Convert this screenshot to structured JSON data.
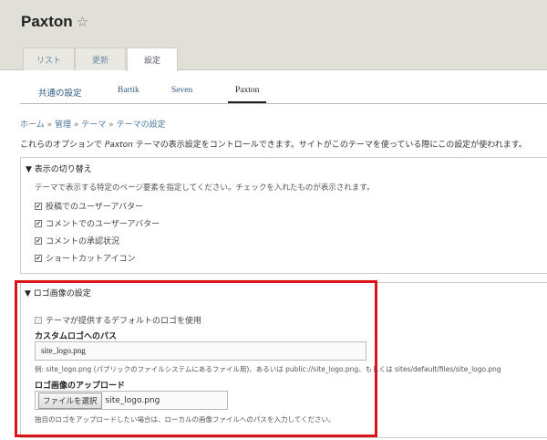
{
  "header": {
    "title": "Paxton",
    "tabs": [
      "リスト",
      "更新",
      "設定"
    ],
    "active_tab": "設定"
  },
  "subtabs": {
    "items": [
      "共通の設定",
      "Bartik",
      "Seven",
      "Paxton"
    ],
    "active": "Paxton"
  },
  "breadcrumb": {
    "items": [
      "ホーム",
      "管理",
      "テーマ",
      "テーマの設定"
    ],
    "separator": "»"
  },
  "description": {
    "before": "これらのオプションで ",
    "theme": "Paxton",
    "after": " テーマの表示設定をコントロールできます。サイトがこのテーマを使っている際にこの設定が使われます。"
  },
  "toggle": {
    "legend": "▼ 表示の切り替え",
    "help": "テーマで表示する特定のページ要素を指定してください。チェックを入れたものが表示されます。",
    "options": [
      {
        "label": "投稿でのユーザーアバター",
        "checked": true
      },
      {
        "label": "コメントでのユーザーアバター",
        "checked": true
      },
      {
        "label": "コメントの承認状況",
        "checked": true
      },
      {
        "label": "ショートカットアイコン",
        "checked": true
      }
    ]
  },
  "logo": {
    "legend": "▼ ロゴ画像の設定",
    "default_label": "テーマが提供するデフォルトのロゴを使用",
    "default_checked": false,
    "path_label": "カスタムロゴへのパス",
    "path_value": "site_logo.png",
    "path_help": "例: site_logo.png (パブリックのファイルシステムにあるファイル用)、あるいは public://site_logo.png、もしくは sites/default/files/site_logo.png",
    "upload_label": "ロゴ画像のアップロード",
    "upload_button": "ファイルを選択",
    "upload_file": "site_logo.png",
    "upload_help": "独自のロゴをアップロードしたい場合は、ローカルの画像ファイルへのパスを入力してください。"
  },
  "colors": {
    "highlight": "#d9141b",
    "link": "#2c5a80",
    "header_bg": "#e0dfd8"
  }
}
